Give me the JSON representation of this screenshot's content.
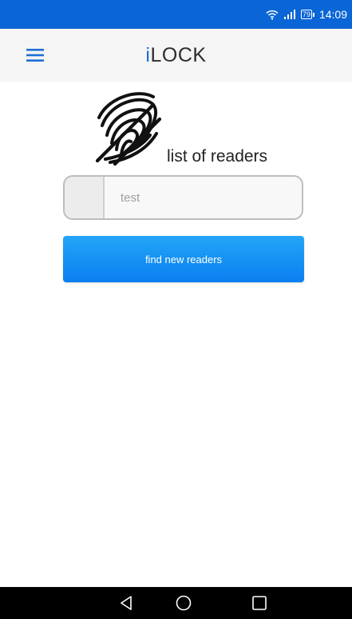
{
  "status_bar": {
    "time": "14:09",
    "battery_level": "79",
    "icons": [
      "wifi-icon",
      "signal-icon",
      "battery-icon"
    ],
    "background_color": "#0a66d6"
  },
  "app_bar": {
    "title_accent": "i",
    "title_rest": "LOCK",
    "menu_icon": "hamburger-menu-icon"
  },
  "main": {
    "logo_icon": "fingerprint-icon",
    "list_title": "list of readers",
    "reader_field": {
      "value": "test"
    },
    "find_button_label": "find new readers"
  },
  "nav_bar": {
    "icons": [
      "back-icon",
      "home-icon",
      "recents-icon"
    ]
  },
  "colors": {
    "accent": "#1e6fd4",
    "button": "#1592f5"
  }
}
